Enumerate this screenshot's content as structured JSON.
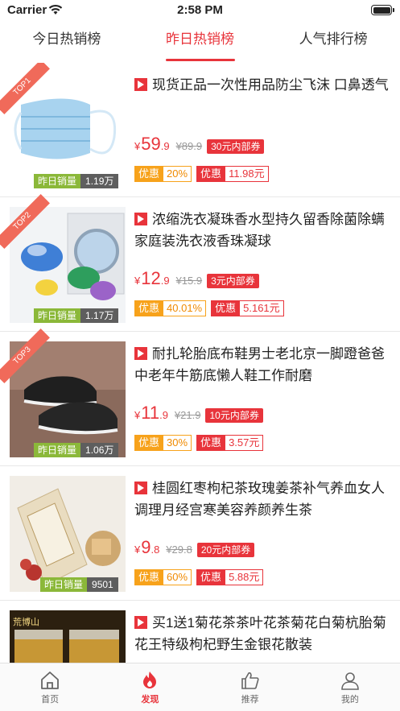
{
  "status_bar": {
    "carrier": "Carrier",
    "time": "2:58 PM"
  },
  "tabs": [
    {
      "label": "今日热销榜",
      "active": false
    },
    {
      "label": "昨日热销榜",
      "active": true
    },
    {
      "label": "人气排行榜",
      "active": false
    }
  ],
  "products": [
    {
      "rank": "TOP1",
      "title": "现货正品一次性用品防尘飞沫 口鼻透气",
      "price_currency": "¥",
      "price_int": "59",
      "price_dec": ".9",
      "old_price": "¥89.9",
      "coupon": "30元内部券",
      "sales_label": "昨日销量",
      "sales_value": "1.19万",
      "discount_label": "优惠",
      "discount_value": "20%",
      "youhui_label": "优惠",
      "youhui_value": "11.98元"
    },
    {
      "rank": "TOP2",
      "title": "浓缩洗衣凝珠香水型持久留香除菌除螨家庭装洗衣液香珠凝球",
      "price_currency": "¥",
      "price_int": "12",
      "price_dec": ".9",
      "old_price": "¥15.9",
      "coupon": "3元内部券",
      "sales_label": "昨日销量",
      "sales_value": "1.17万",
      "discount_label": "优惠",
      "discount_value": "40.01%",
      "youhui_label": "优惠",
      "youhui_value": "5.161元"
    },
    {
      "rank": "TOP3",
      "title": "耐扎轮胎底布鞋男士老北京一脚蹬爸爸中老年牛筋底懒人鞋工作耐磨",
      "price_currency": "¥",
      "price_int": "11",
      "price_dec": ".9",
      "old_price": "¥21.9",
      "coupon": "10元内部券",
      "sales_label": "昨日销量",
      "sales_value": "1.06万",
      "discount_label": "优惠",
      "discount_value": "30%",
      "youhui_label": "优惠",
      "youhui_value": "3.57元"
    },
    {
      "rank": "",
      "title": "桂圆红枣枸杞茶玫瑰姜茶补气养血女人调理月经宫寒美容养颜养生茶",
      "price_currency": "¥",
      "price_int": "9",
      "price_dec": ".8",
      "old_price": "¥29.8",
      "coupon": "20元内部券",
      "sales_label": "昨日销量",
      "sales_value": "9501",
      "discount_label": "优惠",
      "discount_value": "60%",
      "youhui_label": "优惠",
      "youhui_value": "5.88元"
    },
    {
      "rank": "",
      "title": "买1送1菊花茶茶叶花茶菊花白菊杭胎菊花王特级枸杞野生金银花散装",
      "thumb_text": "荒博山"
    }
  ],
  "tabbar": [
    {
      "label": "首页",
      "icon": "home-icon",
      "active": false
    },
    {
      "label": "发现",
      "icon": "flame-icon",
      "active": true
    },
    {
      "label": "推荐",
      "icon": "thumbs-up-icon",
      "active": false
    },
    {
      "label": "我的",
      "icon": "user-icon",
      "active": false
    }
  ],
  "colors": {
    "accent": "#e8343b",
    "orange": "#f7a21b",
    "sales_green": "#8bb839"
  }
}
